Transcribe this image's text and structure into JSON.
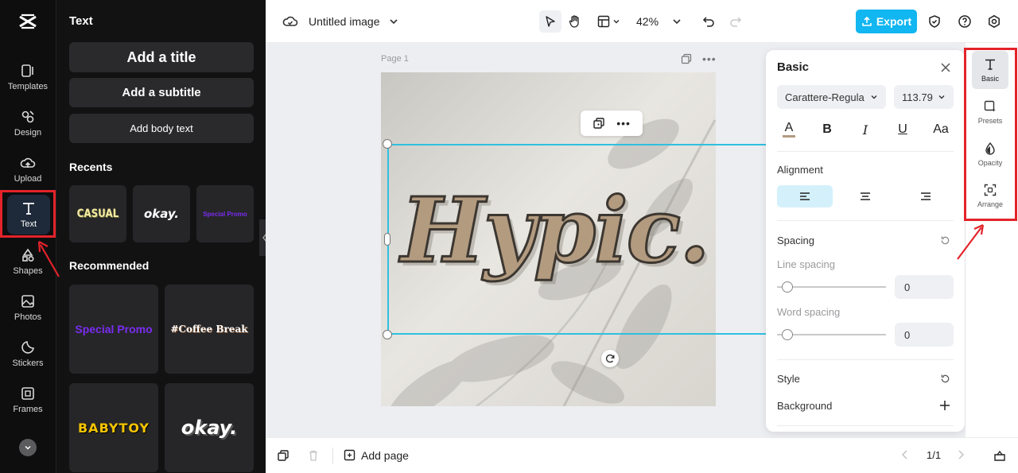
{
  "rail": {
    "items": [
      {
        "label": "Templates"
      },
      {
        "label": "Design"
      },
      {
        "label": "Upload"
      },
      {
        "label": "Text"
      },
      {
        "label": "Shapes"
      },
      {
        "label": "Photos"
      },
      {
        "label": "Stickers"
      },
      {
        "label": "Frames"
      }
    ],
    "active": "Text"
  },
  "panel": {
    "title": "Text",
    "add_title": "Add a title",
    "add_subtitle": "Add a subtitle",
    "add_body": "Add body text",
    "recents_title": "Recents",
    "recents": [
      "CASUAL",
      "okay.",
      "Special Promo"
    ],
    "recommended_title": "Recommended",
    "recommended": [
      "Special Promo",
      "#Coffee Break",
      "BABYTOY",
      "okay."
    ]
  },
  "topbar": {
    "doc_title": "Untitled image",
    "zoom": "42%",
    "export_label": "Export"
  },
  "canvas": {
    "page_label": "Page 1",
    "text_content": "Hypic."
  },
  "bottombar": {
    "add_page": "Add page",
    "page_count": "1/1"
  },
  "props": {
    "header": "Basic",
    "font": "Carattere-Regula",
    "font_size": "113.79",
    "format": {
      "bold": "B",
      "italic": "I",
      "underline": "U",
      "case": "Aa",
      "color": "A"
    },
    "alignment_title": "Alignment",
    "spacing_title": "Spacing",
    "line_spacing_label": "Line spacing",
    "line_spacing": "0",
    "word_spacing_label": "Word spacing",
    "word_spacing": "0",
    "style_title": "Style",
    "background_label": "Background"
  },
  "side_tabs": [
    {
      "label": "Basic"
    },
    {
      "label": "Presets"
    },
    {
      "label": "Opacity"
    },
    {
      "label": "Arrange"
    }
  ],
  "colors": {
    "accent": "#12b6f0",
    "selection": "#2fc0e0",
    "annotation": "#e3232a",
    "text_fill": "#b39b80"
  }
}
